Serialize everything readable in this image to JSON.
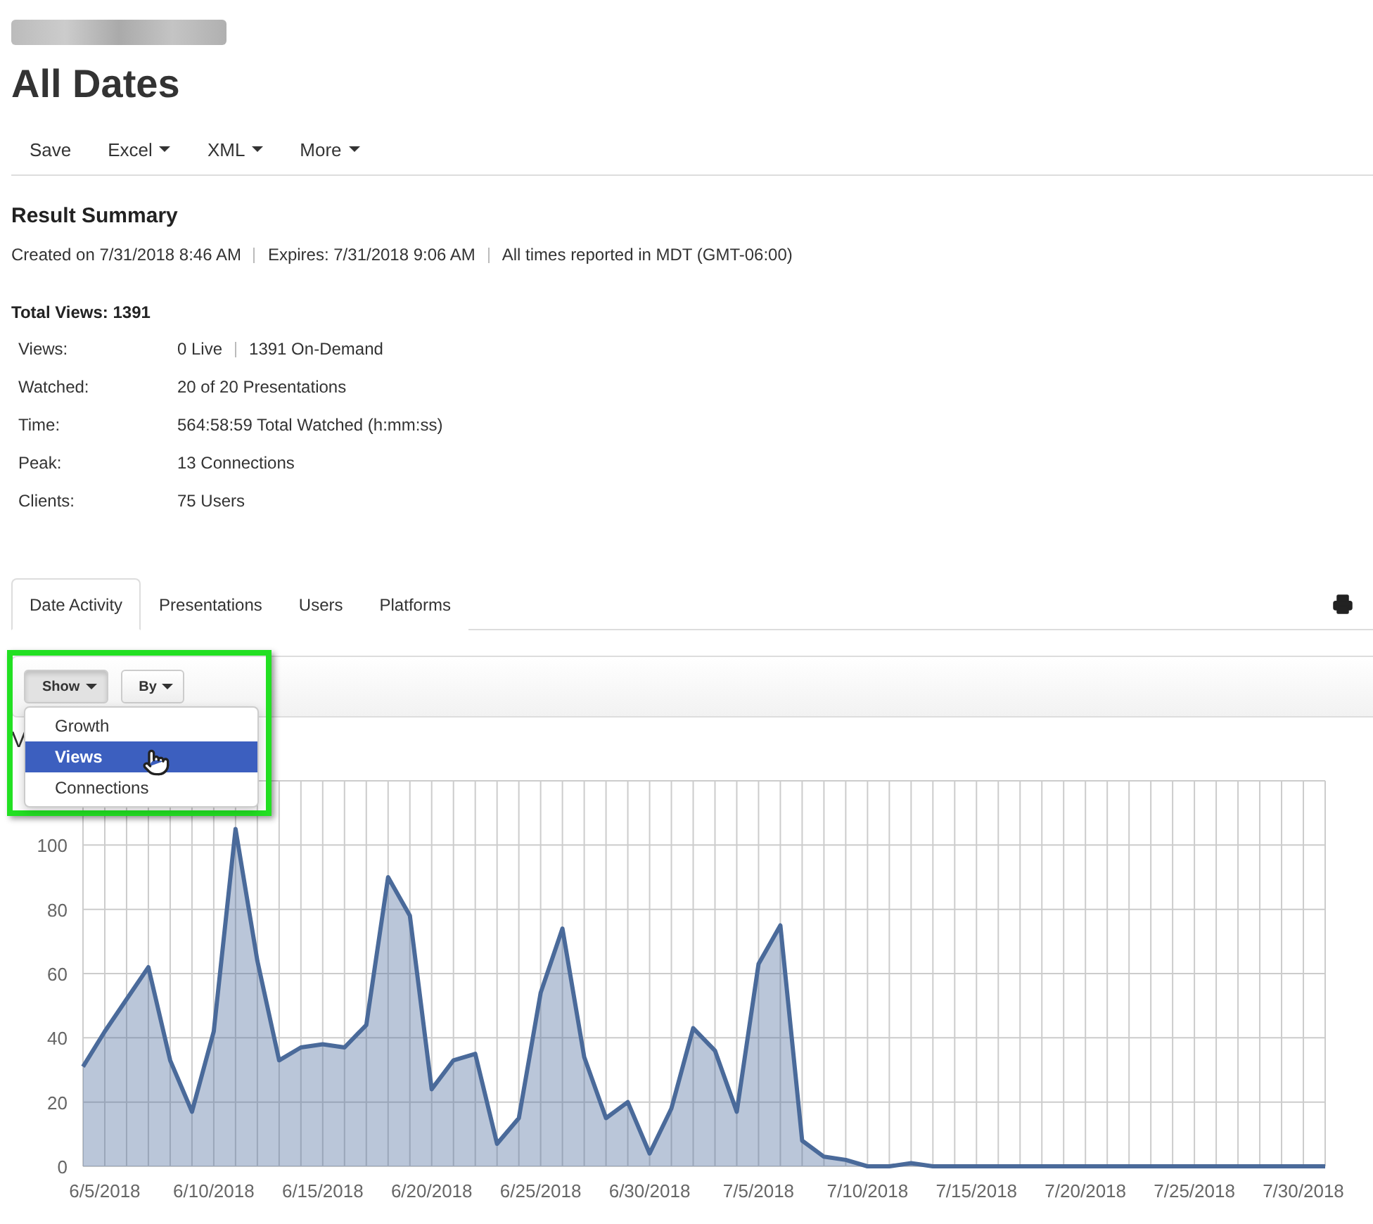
{
  "title": "All Dates",
  "toolbar": [
    {
      "label": "Save",
      "menu": false
    },
    {
      "label": "Excel",
      "menu": true
    },
    {
      "label": "XML",
      "menu": true
    },
    {
      "label": "More",
      "menu": true
    }
  ],
  "summary": {
    "heading": "Result Summary",
    "meta": [
      "Created on 7/31/2018 8:46 AM",
      "Expires: 7/31/2018 9:06 AM",
      "All times reported in MDT (GMT-06:00)"
    ],
    "total": "Total Views: 1391",
    "stats": [
      {
        "label": "Views:",
        "values": [
          "0 Live",
          "1391 On-Demand"
        ]
      },
      {
        "label": "Watched:",
        "values": [
          "20 of 20 Presentations"
        ]
      },
      {
        "label": "Time:",
        "values": [
          "564:58:59 Total Watched (h:mm:ss)"
        ]
      },
      {
        "label": "Peak:",
        "values": [
          "13 Connections"
        ]
      },
      {
        "label": "Clients:",
        "values": [
          "75 Users"
        ]
      }
    ]
  },
  "tabs": [
    {
      "label": "Date Activity",
      "selected": true
    },
    {
      "label": "Presentations",
      "selected": false
    },
    {
      "label": "Users",
      "selected": false
    },
    {
      "label": "Platforms",
      "selected": false
    }
  ],
  "chart_toolbar": [
    {
      "label": "Show",
      "open": true
    },
    {
      "label": "By",
      "open": false
    }
  ],
  "show_menu": [
    {
      "label": "Growth",
      "selected": false
    },
    {
      "label": "Views",
      "selected": true
    },
    {
      "label": "Connections",
      "selected": false
    }
  ],
  "chart_data": {
    "type": "area",
    "title": "V",
    "grid": true,
    "categories": [
      null,
      "6/5/2018",
      null,
      null,
      null,
      null,
      "6/10/2018",
      null,
      null,
      null,
      null,
      "6/15/2018",
      null,
      null,
      null,
      null,
      "6/20/2018",
      null,
      null,
      null,
      null,
      "6/25/2018",
      null,
      null,
      null,
      null,
      "6/30/2018",
      null,
      null,
      null,
      null,
      "7/5/2018",
      null,
      null,
      null,
      null,
      "7/10/2018",
      null,
      null,
      null,
      null,
      "7/15/2018",
      null,
      null,
      null,
      null,
      "7/20/2018",
      null,
      null,
      null,
      null,
      "7/25/2018",
      null,
      null,
      null,
      null,
      "7/30/2018",
      null
    ],
    "series": [
      {
        "color": "#4a6a9a",
        "values": [
          31,
          42,
          52,
          62,
          33,
          17,
          42,
          105,
          64,
          33,
          37,
          38,
          37,
          44,
          90,
          78,
          24,
          33,
          35,
          7,
          15,
          54,
          74,
          34,
          15,
          20,
          4,
          18,
          43,
          36,
          17,
          63,
          75,
          8,
          3,
          2,
          0,
          0,
          1,
          0,
          0,
          0,
          0,
          0,
          0,
          0,
          0,
          0,
          0,
          0,
          0,
          0,
          0,
          0,
          0,
          0,
          0,
          0
        ]
      }
    ],
    "ylim": [
      0,
      120
    ],
    "yticks": [
      0,
      20,
      40,
      60,
      80,
      100
    ]
  }
}
